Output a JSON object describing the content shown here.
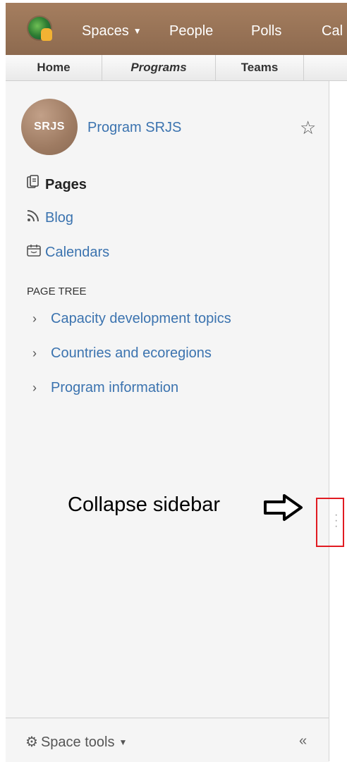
{
  "topnav": {
    "items": [
      {
        "label": "Spaces",
        "has_caret": true
      },
      {
        "label": "People"
      },
      {
        "label": "Polls"
      },
      {
        "label": "Cal"
      }
    ]
  },
  "tabs": [
    {
      "label": "Home"
    },
    {
      "label": "Programs"
    },
    {
      "label": "Teams"
    }
  ],
  "sidebar": {
    "avatar_text": "SRJS",
    "space_title": "Program SRJS",
    "star_icon": "star-icon",
    "nav": [
      {
        "label": "Pages",
        "icon": "pages-icon"
      },
      {
        "label": "Blog",
        "icon": "rss-icon"
      },
      {
        "label": "Calendars",
        "icon": "calendar-icon"
      }
    ],
    "page_tree_heading": "PAGE TREE",
    "page_tree": [
      {
        "label": "Capacity development topics"
      },
      {
        "label": "Countries and ecoregions"
      },
      {
        "label": "Program information"
      }
    ],
    "space_tools_label": "Space tools",
    "collapse_chevrons": "«"
  },
  "annotation": {
    "text": "Collapse sidebar"
  },
  "colors": {
    "nav_bg": "#9a7558",
    "link": "#3b73af",
    "highlight": "#e11b22"
  }
}
